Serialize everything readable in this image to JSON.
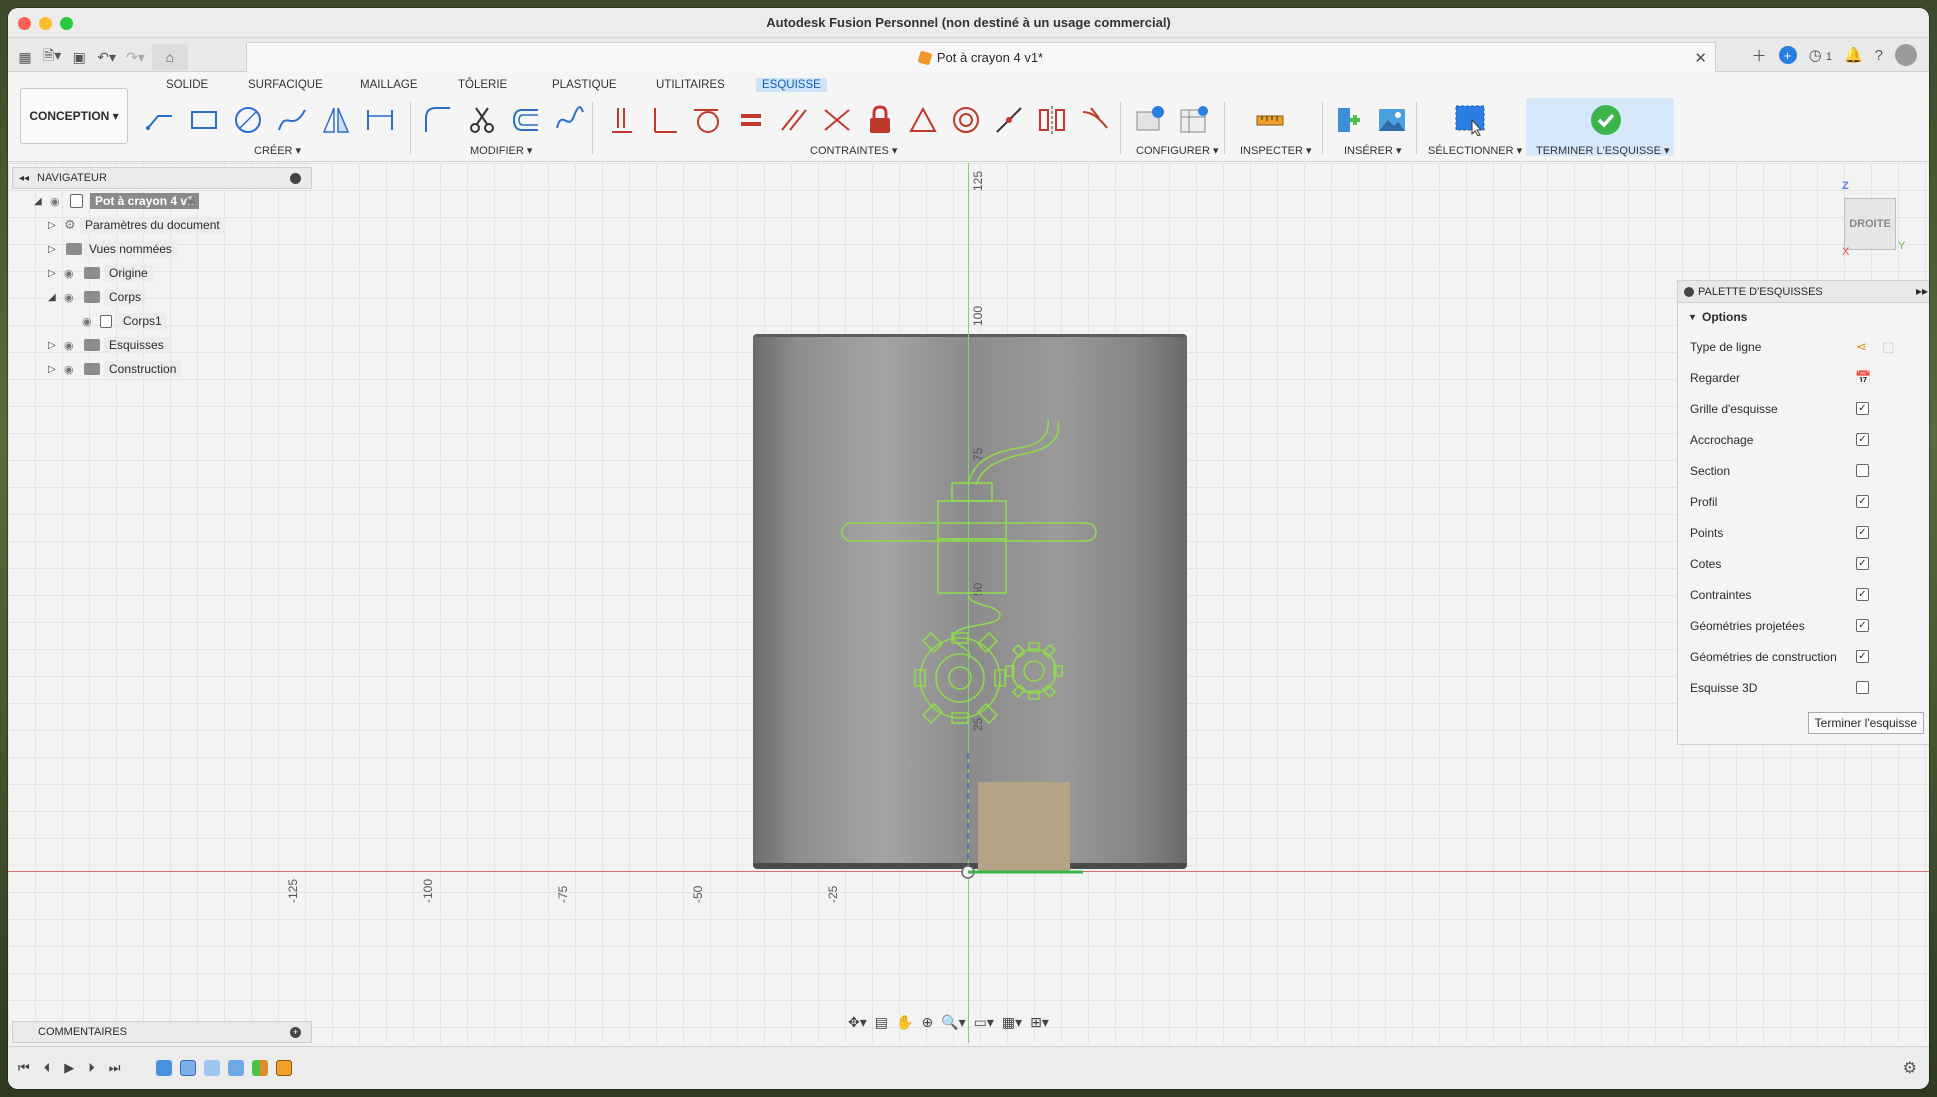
{
  "window": {
    "title": "Autodesk Fusion Personnel (non destiné à un usage commercial)"
  },
  "tabbar": {
    "doc_title": "Pot à crayon 4 v1*",
    "job_count": "1"
  },
  "ribbon": {
    "workspace": "CONCEPTION",
    "tabs": [
      "SOLIDE",
      "SURFACIQUE",
      "MAILLAGE",
      "TÔLERIE",
      "PLASTIQUE",
      "UTILITAIRES",
      "ESQUISSE"
    ],
    "active_tab": "ESQUISSE",
    "groups": {
      "creer": "CRÉER ▾",
      "modifier": "MODIFIER ▾",
      "contraintes": "CONTRAINTES ▾",
      "configurer": "CONFIGURER ▾",
      "inspecter": "INSPECTER ▾",
      "inserer": "INSÉRER ▾",
      "selectionner": "SÉLECTIONNER ▾",
      "terminer": "TERMINER L'ESQUISSE ▾"
    },
    "accent": "#1561b0"
  },
  "navigator": {
    "header": "NAVIGATEUR",
    "items": [
      {
        "label": "Pot à crayon 4 v1"
      },
      {
        "label": "Paramètres du document"
      },
      {
        "label": "Vues nommées"
      },
      {
        "label": "Origine"
      },
      {
        "label": "Corps"
      },
      {
        "label": "Corps1"
      },
      {
        "label": "Esquisses"
      },
      {
        "label": "Construction"
      }
    ]
  },
  "viewport": {
    "y_ticks": [
      "125",
      "100",
      "75",
      "50",
      "25"
    ],
    "x_ticks": [
      "-125",
      "-100",
      "-75",
      "-50",
      "-25"
    ],
    "view_cube": {
      "face": "DROITE",
      "z": "Z",
      "x": "X",
      "y": "Y"
    }
  },
  "palette": {
    "header": "PALETTE D'ESQUISSES",
    "section": "Options",
    "rows": [
      {
        "label": "Type de ligne",
        "kind": "icons"
      },
      {
        "label": "Regarder",
        "kind": "icon"
      },
      {
        "label": "Grille d'esquisse",
        "checked": true
      },
      {
        "label": "Accrochage",
        "checked": true
      },
      {
        "label": "Section",
        "checked": false
      },
      {
        "label": "Profil",
        "checked": true
      },
      {
        "label": "Points",
        "checked": true
      },
      {
        "label": "Cotes",
        "checked": true
      },
      {
        "label": "Contraintes",
        "checked": true
      },
      {
        "label": "Géométries projetées",
        "checked": true
      },
      {
        "label": "Géométries de construction",
        "checked": true
      },
      {
        "label": "Esquisse 3D",
        "checked": false
      }
    ],
    "finish_button": "Terminer l'esquisse"
  },
  "comments": {
    "header": "COMMENTAIRES"
  }
}
